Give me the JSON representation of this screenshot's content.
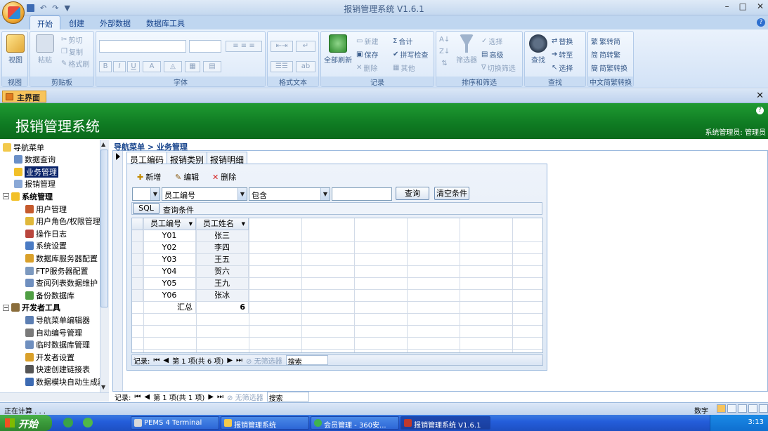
{
  "window": {
    "title": "报销管理系统 V1.6.1",
    "controls": [
      "–",
      "□",
      "✕"
    ]
  },
  "qat": [
    "▼"
  ],
  "ribbon": {
    "tabs": [
      "开始",
      "创建",
      "外部数据",
      "数据库工具"
    ],
    "groups": {
      "view": {
        "name": "视图",
        "big": "视图"
      },
      "clipboard": {
        "name": "剪贴板",
        "paste": "粘贴",
        "cut": "剪切",
        "copy": "复制",
        "format": "格式刷"
      },
      "font": {
        "name": "字体",
        "bold": "B",
        "italic": "I",
        "underline": "U",
        "fontcolor": "A"
      },
      "richtext": {
        "name": "格式文本"
      },
      "records": {
        "name": "记录",
        "refresh": "全部刷新",
        "new": "新建",
        "save": "保存",
        "delete": "删除",
        "total": "合计",
        "spell": "拼写检查",
        "other": "其他"
      },
      "sortfilter": {
        "name": "排序和筛选",
        "filter": "筛选器",
        "select": "选择",
        "advanced": "高级",
        "toggle": "切换筛选"
      },
      "find": {
        "name": "查找",
        "find": "查找",
        "replace": "替换",
        "goto": "转至",
        "select": "选择"
      },
      "chinese": {
        "name": "中文简繁转换",
        "t2s": "繁转简",
        "s2t": "简转繁",
        "convert": "简繁转换"
      }
    }
  },
  "doc_tab": {
    "label": "主界面"
  },
  "header": {
    "title": "报销管理系统",
    "user": "系统管理员: 管理员"
  },
  "nav": {
    "items": [
      {
        "label": "导航菜单",
        "level": 0,
        "icon": "folder-open-icon"
      },
      {
        "label": "数据查询",
        "level": 1,
        "icon": "query-icon"
      },
      {
        "label": "业务管理",
        "level": 1,
        "icon": "star-icon",
        "selected": true
      },
      {
        "label": "报销管理",
        "level": 1,
        "icon": "form-icon"
      },
      {
        "label": "系统管理",
        "level": 0,
        "icon": "star-icon",
        "group": true
      },
      {
        "label": "用户管理",
        "level": 2,
        "icon": "users-icon"
      },
      {
        "label": "用户角色/权限管理",
        "level": 2,
        "icon": "lock-icon"
      },
      {
        "label": "操作日志",
        "level": 2,
        "icon": "log-icon"
      },
      {
        "label": "系统设置",
        "level": 2,
        "icon": "settings-icon"
      },
      {
        "label": "数据库服务器配置",
        "level": 2,
        "icon": "database-icon"
      },
      {
        "label": "FTP服务器配置",
        "level": 2,
        "icon": "ftp-icon"
      },
      {
        "label": "查阅列表数据维护",
        "level": 2,
        "icon": "list-icon"
      },
      {
        "label": "备份数据库",
        "level": 2,
        "icon": "backup-icon"
      },
      {
        "label": "开发者工具",
        "level": 0,
        "icon": "tools-icon",
        "group": true
      },
      {
        "label": "导航菜单编辑器",
        "level": 2,
        "icon": "menu-icon"
      },
      {
        "label": "自动编号管理",
        "level": 2,
        "icon": "number-icon"
      },
      {
        "label": "临时数据库管理",
        "level": 2,
        "icon": "tempdb-icon"
      },
      {
        "label": "开发者设置",
        "level": 2,
        "icon": "dev-settings-icon"
      },
      {
        "label": "快速创建链接表",
        "level": 2,
        "icon": "link-icon"
      },
      {
        "label": "数据模块自动生成器",
        "level": 2,
        "icon": "generator-icon"
      }
    ]
  },
  "content": {
    "breadcrumb": "导航菜单 > 业务管理",
    "subtabs": [
      "员工编码",
      "报销类别",
      "报销明细"
    ],
    "toolbar": {
      "new": "新增",
      "edit": "编辑",
      "delete": "删除"
    },
    "query": {
      "field": "员工编号",
      "op": "包含",
      "value": "",
      "btn_query": "查询",
      "btn_clear": "清空条件",
      "sql": "SQL",
      "cond_label": "查询条件"
    },
    "grid": {
      "columns": [
        "员工编号",
        "员工姓名"
      ],
      "rows": [
        [
          "Y01",
          "张三"
        ],
        [
          "Y02",
          "李四"
        ],
        [
          "Y03",
          "王五"
        ],
        [
          "Y04",
          "贺六"
        ],
        [
          "Y05",
          "王九"
        ],
        [
          "Y06",
          "张冰"
        ]
      ],
      "total_label": "汇总",
      "total_value": "6"
    },
    "inner_nav": {
      "label": "记录:",
      "pos": "第 1 项(共 6 项)",
      "nofilter": "无筛选器",
      "search": "搜索"
    },
    "outer_nav": {
      "label": "记录:",
      "pos": "第 1 项(共 1 项)",
      "nofilter": "无筛选器",
      "search": "搜索"
    }
  },
  "status": {
    "left": "正在计算 . . .",
    "right": "数字"
  },
  "taskbar": {
    "start": "开始",
    "tasks": [
      "PEMS 4 Terminal",
      "报销管理系统",
      "会员管理 - 360安...",
      "报销管理系统 V1.6.1"
    ],
    "clock": "3:13"
  }
}
